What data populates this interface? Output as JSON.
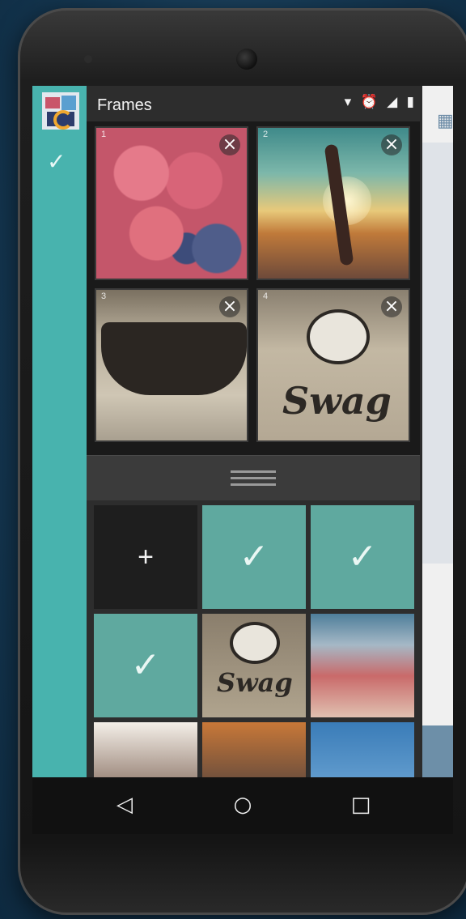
{
  "app": {
    "title": "Frames"
  },
  "status_icons": [
    "wifi-icon",
    "alarm-icon",
    "signal-icon",
    "battery-icon"
  ],
  "status_glyphs": "▾ ⏰ ◢ ▮",
  "frames": [
    {
      "number": "1",
      "close": "×"
    },
    {
      "number": "2",
      "close": "×"
    },
    {
      "number": "3",
      "close": "×"
    },
    {
      "number": "4",
      "close": "×"
    }
  ],
  "gallery": {
    "add_label": "+",
    "check_glyph": "✓",
    "swag_text": "Swag"
  },
  "left_panel": {
    "check_glyph": "✓"
  },
  "nav": {
    "back": "◁",
    "home": "○",
    "recents": "□"
  },
  "colors": {
    "accent": "#48b3ae",
    "selected_overlay": "#5fa99f",
    "background": "#2d2d2d"
  }
}
